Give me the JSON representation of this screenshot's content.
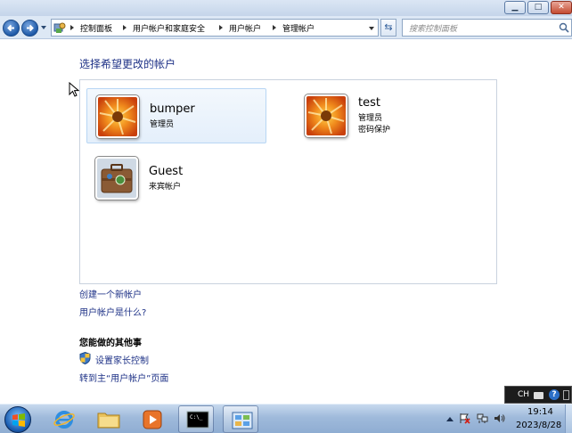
{
  "window": {
    "min_label": "▁",
    "max_label": "□",
    "close_label": "✕"
  },
  "address": {
    "breadcrumbs": [
      "控制面板",
      "用户帐户和家庭安全",
      "用户帐户",
      "管理帐户"
    ]
  },
  "search": {
    "placeholder": "搜索控制面板"
  },
  "heading": "选择希望更改的帐户",
  "accounts": [
    {
      "name": "bumper",
      "lines": [
        "管理员"
      ],
      "picture": "flower"
    },
    {
      "name": "test",
      "lines": [
        "管理员",
        "密码保护"
      ],
      "picture": "flower"
    },
    {
      "name": "Guest",
      "lines": [
        "来宾帐户"
      ],
      "picture": "briefcase"
    }
  ],
  "links": {
    "create_account": "创建一个新帐户",
    "what_is_account": "用户帐户是什么?"
  },
  "other": {
    "title": "您能做的其他事",
    "parental": "设置家长控制",
    "main_page": "转到主“用户帐户”页面"
  },
  "langbar": {
    "text": "CH",
    "help": "?"
  },
  "taskbar": {
    "apps": [
      "internet-explorer-icon",
      "folder-icon",
      "media-player-icon",
      "cmd-icon",
      "control-panel-icon"
    ],
    "time": "19:14",
    "date": "2023/8/28"
  },
  "colors": {
    "link": "#1e3287",
    "selected_bg": "#e4effb",
    "taskbar": "#9fbadb"
  }
}
